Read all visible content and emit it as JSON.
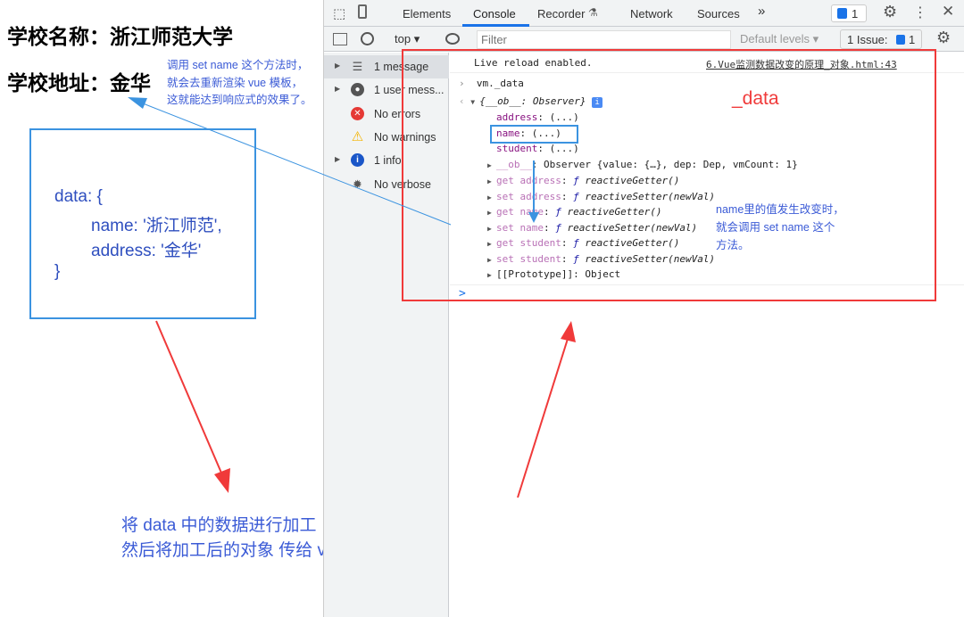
{
  "page": {
    "school_name": "学校名称：浙江师范大学",
    "school_address": "学校地址：金华",
    "note_left": [
      "调用 set name 这个方法时，",
      "就会去重新渲染 vue 模板，",
      "这就能达到响应式的效果了。"
    ],
    "data_box": [
      "data: {",
      "name: '浙江师范',",
      "address: '金华'",
      "}"
    ],
    "bottom_note": [
      "将 data 中的数据进行加工（添加getter 和 setter，通过Object.defineProperty()方法)",
      "然后将加工后的对象 传给 vm 的 _data 属性"
    ]
  },
  "devtools": {
    "tabs": [
      "Elements",
      "Console",
      "Recorder",
      "Network",
      "Sources"
    ],
    "active_tab": "Console",
    "more": "»",
    "badge_count": "1",
    "toolbar": {
      "context": "top",
      "filter_placeholder": "Filter",
      "levels": "Default levels",
      "issues": "1 Issue:",
      "issues_count": "1"
    },
    "sidebar": [
      {
        "label": "1 message",
        "icon": "list-icon"
      },
      {
        "label": "1 user mess...",
        "icon": "user-icon"
      },
      {
        "label": "No errors",
        "icon": "error-icon"
      },
      {
        "label": "No warnings",
        "icon": "warning-icon"
      },
      {
        "label": "1 info",
        "icon": "info-icon"
      },
      {
        "label": "No verbose",
        "icon": "bug-icon"
      }
    ],
    "console": {
      "live_reload": "Live reload enabled.",
      "source_link": "6.Vue监测数据改变的原理_对象.html:43",
      "input": "vm._data",
      "object_header": "{__ob__: Observer}",
      "props": [
        {
          "k": "address",
          "v": ": (...)"
        },
        {
          "k": "name",
          "v": ": (...)"
        },
        {
          "k": "student",
          "v": ": (...)"
        }
      ],
      "ob_row": {
        "k": "__ob__",
        "v": ": Observer {value: {…}, dep: Dep, vmCount: 1}"
      },
      "accessors": [
        {
          "k": "get address",
          "v": "reactiveGetter()"
        },
        {
          "k": "set address",
          "v": "reactiveSetter(newVal)"
        },
        {
          "k": "get name",
          "v": "reactiveGetter()"
        },
        {
          "k": "set name",
          "v": "reactiveSetter(newVal)"
        },
        {
          "k": "get student",
          "v": "reactiveGetter()"
        },
        {
          "k": "set student",
          "v": "reactiveSetter(newVal)"
        }
      ],
      "f": "ƒ",
      "prototype": "[[Prototype]]: Object",
      "prompt": ">"
    },
    "annotation_data": "_data",
    "annotation_note": [
      "name里的值发生改变时，",
      "就会调用 set name 这个",
      "方法。"
    ]
  },
  "colors": {
    "red": "#f03a3a",
    "blue": "#3b93e0",
    "text_blue": "#3b5bd6"
  }
}
